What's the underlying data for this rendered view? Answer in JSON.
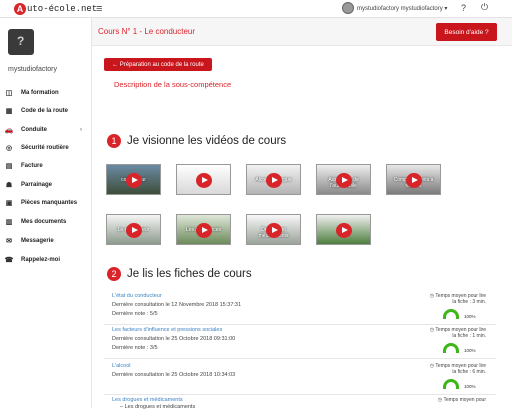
{
  "topbar": {
    "logo_a": "A",
    "logo_text": "uto-école.net",
    "username": "mystudiofactory mystudiofactory ▾",
    "question_icon": "?",
    "power_icon": "⏻"
  },
  "sidebar": {
    "username": "mystudiofactory",
    "items": [
      {
        "label": "Ma formation",
        "icon": "◫"
      },
      {
        "label": "Code de la route",
        "icon": "▦"
      },
      {
        "label": "Conduite",
        "icon": "🚗",
        "has_submenu": true
      },
      {
        "label": "Sécurité routière",
        "icon": "◎"
      },
      {
        "label": "Facture",
        "icon": "▤"
      },
      {
        "label": "Parrainage",
        "icon": "☗"
      },
      {
        "label": "Pièces manquantes",
        "icon": "▣"
      },
      {
        "label": "Mes documents",
        "icon": "▥"
      },
      {
        "label": "Messagerie",
        "icon": "✉"
      },
      {
        "label": "Rappelez-moi",
        "icon": "☎"
      }
    ]
  },
  "header": {
    "title": "Cours N° 1 - Le conducteur",
    "help_button": "Besoin d'aide ?"
  },
  "content": {
    "prep_button": "← Préparation au code de la route",
    "subcomp_link": "Description de la sous-compétence",
    "section1": {
      "number": "1",
      "title": "Je visionne les vidéos de cours"
    },
    "section2": {
      "number": "2",
      "title": "Je lis les fiches de cours"
    },
    "videos": [
      {
        "label": "conducteur"
      },
      {
        "label": ""
      },
      {
        "label": "Alcool et drogue"
      },
      {
        "label": "Assurance de l'automobile"
      },
      {
        "label": "Comportements à risques"
      },
      {
        "label": "Le conducteur"
      },
      {
        "label": "Les assurances"
      },
      {
        "label": "Drogues et médicaments"
      },
      {
        "label": ""
      }
    ],
    "fiches": [
      {
        "title": "L'état du conducteur",
        "consult": "Dernière consultation le 12 Novembre 2018 15:37:31",
        "note": "Dernière note : 5/5",
        "time_label": "Temps moyen pour lire la fiche : 3 min.",
        "percent": "100%"
      },
      {
        "title": "Les facteurs d'influence et pressions sociales",
        "consult": "Dernière consultation le 25 Octobre 2018 09:31:00",
        "note": "Dernière note : 3/5",
        "time_label": "Temps moyen pour lire la fiche : 1 min.",
        "percent": "100%"
      },
      {
        "title": "L'alcool",
        "consult": "Dernière consultation le 25 Octobre 2018 10:34:03",
        "note": "",
        "time_label": "Temps moyen pour lire la fiche : 6 min.",
        "percent": "100%"
      },
      {
        "title": "Les drogues et médicaments",
        "consult": "– Les drogues et médicaments",
        "note": "",
        "time_label": "Temps moyen pour",
        "percent": ""
      }
    ]
  }
}
